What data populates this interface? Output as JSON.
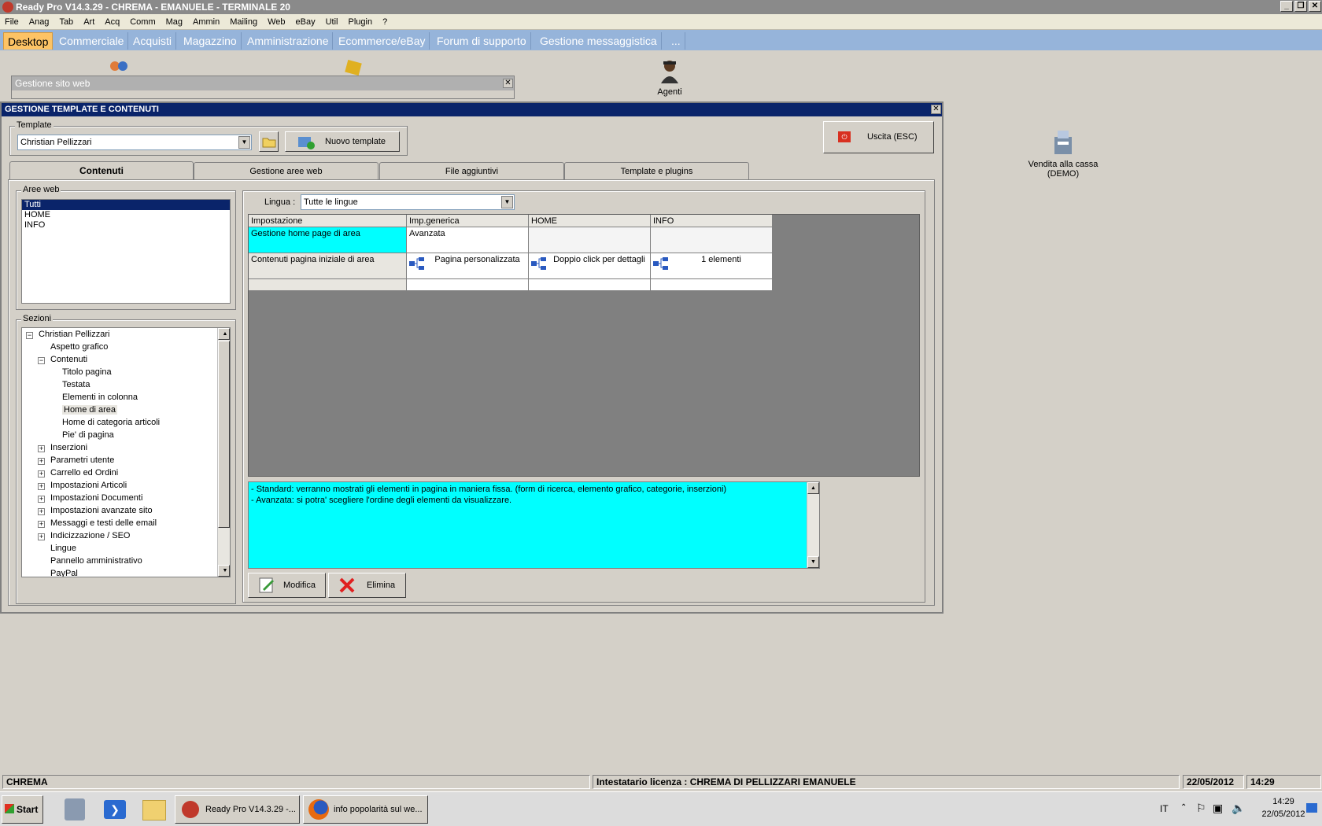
{
  "window": {
    "title": "Ready Pro V14.3.29 - CHREMA - EMANUELE - TERMINALE 20"
  },
  "menu": [
    "File",
    "Anag",
    "Tab",
    "Art",
    "Acq",
    "Comm",
    "Mag",
    "Ammin",
    "Mailing",
    "Web",
    "eBay",
    "Util",
    "Plugin",
    "?"
  ],
  "top_tabs": [
    "Desktop",
    "Commerciale",
    "Acquisti",
    "Magazzino",
    "Amministrazione",
    "Ecommerce/eBay",
    "Forum di supporto",
    "Gestione messaggistica",
    "..."
  ],
  "desktop_icons": {
    "agenti": "Agenti",
    "vendita_line1": "Vendita alla cassa",
    "vendita_line2": "(DEMO)"
  },
  "bg_dialog": {
    "title": "Gestione sito web"
  },
  "dialog": {
    "title": "GESTIONE TEMPLATE E CONTENUTI",
    "template_legend": "Template",
    "template_value": "Christian Pellizzari",
    "new_template": "Nuovo template",
    "exit": "Uscita (ESC)",
    "panel_tabs": [
      "Contenuti",
      "Gestione aree web",
      "File aggiuntivi",
      "Template e plugins"
    ],
    "aree_legend": "Aree web",
    "aree": [
      "Tutti",
      "HOME",
      "INFO"
    ],
    "sezioni_legend": "Sezioni",
    "tree": [
      {
        "label": "Christian Pellizzari",
        "level": 0,
        "exp": "⊟"
      },
      {
        "label": "Aspetto grafico",
        "level": 1,
        "exp": ""
      },
      {
        "label": "Contenuti",
        "level": 1,
        "exp": "⊟"
      },
      {
        "label": "Titolo pagina",
        "level": 2,
        "exp": ""
      },
      {
        "label": "Testata",
        "level": 2,
        "exp": ""
      },
      {
        "label": "Elementi in colonna",
        "level": 2,
        "exp": ""
      },
      {
        "label": "Home di area",
        "level": 2,
        "exp": "",
        "selected": true
      },
      {
        "label": "Home di categoria articoli",
        "level": 2,
        "exp": ""
      },
      {
        "label": "Pie' di pagina",
        "level": 2,
        "exp": ""
      },
      {
        "label": "Inserzioni",
        "level": 1,
        "exp": "⊞"
      },
      {
        "label": "Parametri utente",
        "level": 1,
        "exp": "⊞"
      },
      {
        "label": "Carrello ed Ordini",
        "level": 1,
        "exp": "⊞"
      },
      {
        "label": "Impostazioni Articoli",
        "level": 1,
        "exp": "⊞"
      },
      {
        "label": "Impostazioni Documenti",
        "level": 1,
        "exp": "⊞"
      },
      {
        "label": "Impostazioni avanzate sito",
        "level": 1,
        "exp": "⊞"
      },
      {
        "label": "Messaggi e testi delle email",
        "level": 1,
        "exp": "⊞"
      },
      {
        "label": "Indicizzazione / SEO",
        "level": 1,
        "exp": "⊞"
      },
      {
        "label": "Lingue",
        "level": 1,
        "exp": ""
      },
      {
        "label": "Pannello amministrativo",
        "level": 1,
        "exp": ""
      },
      {
        "label": "PayPal",
        "level": 1,
        "exp": ""
      }
    ],
    "lingua_label": "Lingua :",
    "lingua_value": "Tutte le lingue",
    "grid_headers": [
      "Impostazione",
      "Imp.generica",
      "HOME",
      "INFO"
    ],
    "grid_rows": [
      [
        "Gestione home page di area",
        "Avanzata",
        "",
        ""
      ],
      [
        "Contenuti pagina iniziale di area",
        "Pagina personalizzata",
        "Doppio click per dettagli",
        "1 elementi"
      ]
    ],
    "description": [
      "- Standard: verranno mostrati gli elementi in pagina in maniera fissa. (form di ricerca, elemento grafico, categorie, inserzioni)",
      "- Avanzata: si potra' scegliere l'ordine degli elementi da visualizzare."
    ],
    "modifica": "Modifica",
    "elimina": "Elimina"
  },
  "status": {
    "company": "CHREMA",
    "license": "Intestatario licenza : CHREMA DI PELLIZZARI EMANUELE",
    "date": "22/05/2012",
    "time": "14:29"
  },
  "taskbar": {
    "start": "Start",
    "task1": "Ready Pro V14.3.29 -...",
    "task2": "info popolarità sul we...",
    "lang": "IT",
    "clock_time": "14:29",
    "clock_date": "22/05/2012"
  }
}
